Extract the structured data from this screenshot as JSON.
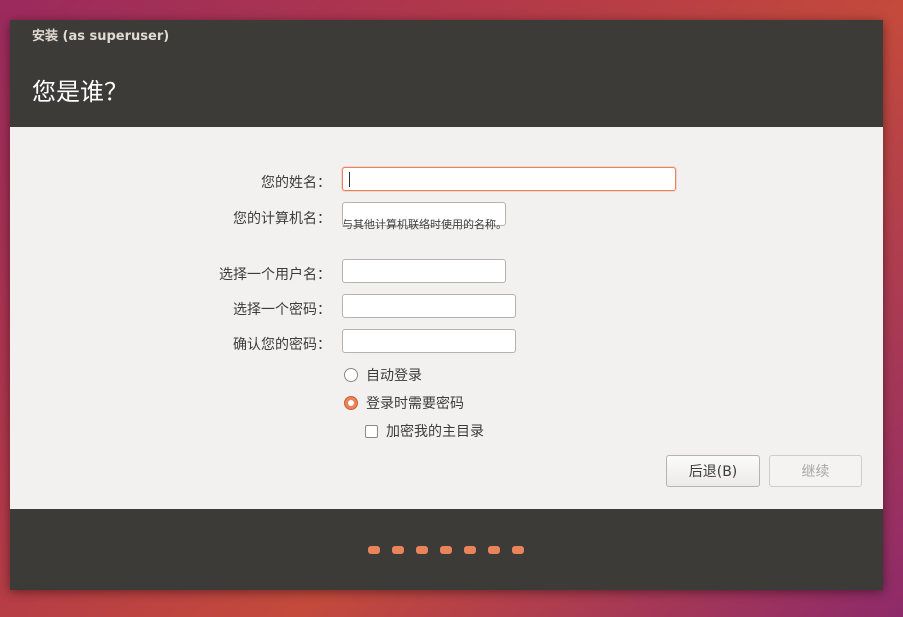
{
  "window": {
    "title": "安装 (as superuser)"
  },
  "header": {
    "title": "您是谁？"
  },
  "form": {
    "name_label": "您的姓名：",
    "name_value": "",
    "computer_label": "您的计算机名：",
    "computer_value": "",
    "computer_hint": "与其他计算机联络时使用的名称。",
    "username_label": "选择一个用户名：",
    "username_value": "",
    "password_label": "选择一个密码：",
    "password_value": "",
    "confirm_label": "确认您的密码：",
    "confirm_value": ""
  },
  "login_options": {
    "auto_login_label": "自动登录",
    "auto_login_selected": false,
    "require_password_label": "登录时需要密码",
    "require_password_selected": true,
    "encrypt_home_label": "加密我的主目录",
    "encrypt_home_checked": false
  },
  "buttons": {
    "back_label": "后退(B)",
    "continue_label": "继续",
    "continue_enabled": false
  },
  "progress": {
    "step_count": 7
  },
  "colors": {
    "accent": "#e9845a",
    "header_bg": "#3c3b37",
    "content_bg": "#f2f1f0"
  }
}
